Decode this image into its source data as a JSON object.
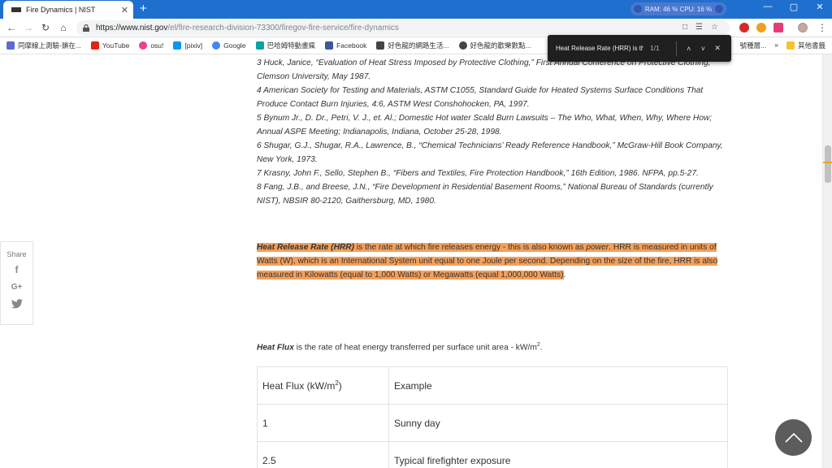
{
  "browser": {
    "tab_title": "Fire Dynamics | NIST",
    "new_tab": "+",
    "sysmon": "RAM: 46 %  CPU: 16 %",
    "url_host": "https://www.nist.gov",
    "url_path": "/el/fire-research-division-73300/firegov-fire-service/fire-dynamics",
    "win_min": "—",
    "win_max": "▢",
    "win_close": "✕"
  },
  "bookmarks": {
    "items": [
      {
        "label": "同摩線上測驗-鎖在...",
        "color": "#5b6bd6"
      },
      {
        "label": "YouTube",
        "color": "#e62117"
      },
      {
        "label": "osu!",
        "color": "#e9418e"
      },
      {
        "label": "[pixiv]",
        "color": "#0096fa"
      },
      {
        "label": "Google",
        "color": "#4285f4"
      },
      {
        "label": "巴哈姆特動畫瘋",
        "color": "#0aa2a5"
      },
      {
        "label": "Facebook",
        "color": "#3b5998"
      },
      {
        "label": "好色龍的網路生活...",
        "color": "#444444"
      },
      {
        "label": "好色龍的歡樂數點...",
        "color": "#444444"
      }
    ],
    "partial": "號種層...",
    "more": "»",
    "other": "其他書籤"
  },
  "findbar": {
    "query": "Heat Release Rate (HRR) is th",
    "count": "1/1",
    "up": "˄",
    "down": "˅",
    "close": "✕"
  },
  "references": [
    "3 Huck, Janice, “Evaluation of Heat Stress Imposed by Protective Clothing,” First Annual Conference on Protective Clothing, Clemson University, May 1987.",
    "4 American Society for Testing and Materials, ASTM C1055, Standard Guide for Heated Systems Surface Conditions That Produce Contact Burn Injuries, 4:6, ASTM West Conshohocken, PA, 1997.",
    "5 Bynum Jr., D. Dr., Petri, V. J., et. Al.; Domestic Hot water Scald Burn Lawsuits – The Who, What, When, Why, Where How; Annual ASPE Meeting; Indianapolis, Indiana, October 25-28, 1998.",
    "6 Shugar, G.J., Shugar, R.A., Lawrence, B., “Chemical Technicians’ Ready Reference Handbook,” McGraw-Hill Book Company, New York, 1973.",
    "7 Krasny, John F., Sello, Stephen B., “Fibers and Textiles, Fire Protection Handbook,” 16th Edition, 1986. NFPA, pp.5-27.",
    "8 Fang, J.B., and Breese, J.N., “Fire Development in Residential Basement Rooms,” National Bureau of Standards (currently NIST), NBSIR 80-2120, Gaithersburg, MD, 1980."
  ],
  "hrr": {
    "term": "Heat Release Rate (HRR)",
    "text1": " is the rate at which fire releases energy - this is also known as ",
    "power": "power",
    "text2": ". HRR is measured in units of Watts (W), which is an International System unit equal to one Joule per second. Depending on the size of the fire, HRR is also measured in Kilowatts (equal to 1,000 Watts) or Megawatts (equal 1,000,000 Watts)",
    "end": "."
  },
  "flux": {
    "term": "Heat Flux",
    "text": " is the rate of heat energy transferred per surface unit area - kW/m",
    "sup": "2",
    "end": "."
  },
  "flux_table": {
    "header_col1": "Heat Flux (kW/m",
    "header_col1_sup": "2",
    "header_col1_end": ")",
    "header_col2": "Example",
    "rows": [
      {
        "flux": "1",
        "example": "Sunny day"
      },
      {
        "flux": "2.5",
        "example": "Typical firefighter exposure"
      }
    ]
  },
  "share": {
    "label": "Share",
    "facebook": "f",
    "googleplus": "G+",
    "twitter": "🐦"
  },
  "colors": {
    "highlight": "#f5a05a",
    "tabstrip": "#1f6fcf"
  }
}
